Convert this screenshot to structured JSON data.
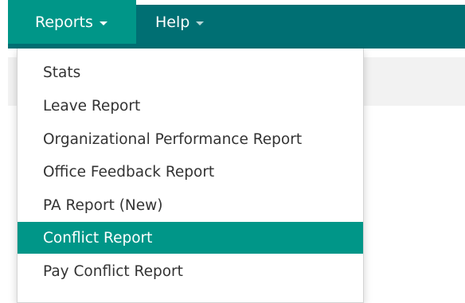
{
  "nav": {
    "reports_label": "Reports",
    "help_label": "Help"
  },
  "menu": {
    "items": [
      {
        "label": "Stats"
      },
      {
        "label": "Leave Report"
      },
      {
        "label": "Organizational Performance Report"
      },
      {
        "label": "Office Feedback Report"
      },
      {
        "label": "PA Report (New)"
      },
      {
        "label": "Conflict Report",
        "active": true
      },
      {
        "label": "Pay Conflict Report"
      }
    ]
  },
  "colors": {
    "navbar": "#006f73",
    "active": "#009688",
    "menu_text": "#333333"
  }
}
